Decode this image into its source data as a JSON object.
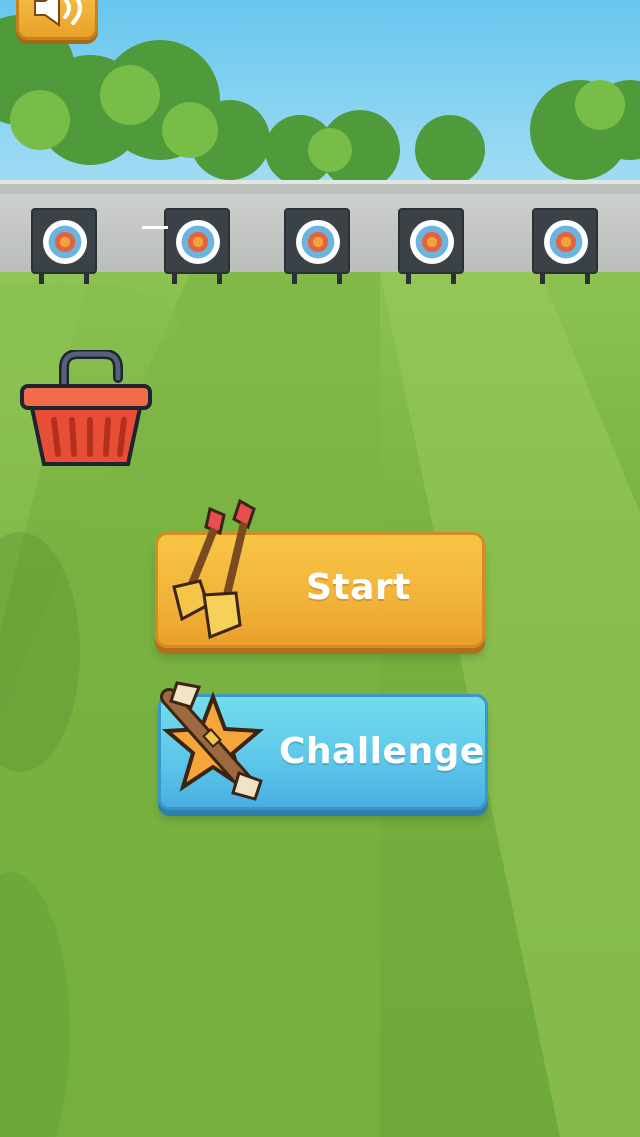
{
  "menu": {
    "start_label": "Start",
    "challenge_label": "Challenge"
  },
  "icons": {
    "sound": "speaker-icon",
    "shop": "basket-icon",
    "start": "arrows-icon",
    "challenge": "crossbow-star-icon"
  },
  "colors": {
    "start_button": "#f2b33a",
    "challenge_button": "#5cc6ea",
    "grass": "#76b03f",
    "sky": "#67c6ee"
  }
}
